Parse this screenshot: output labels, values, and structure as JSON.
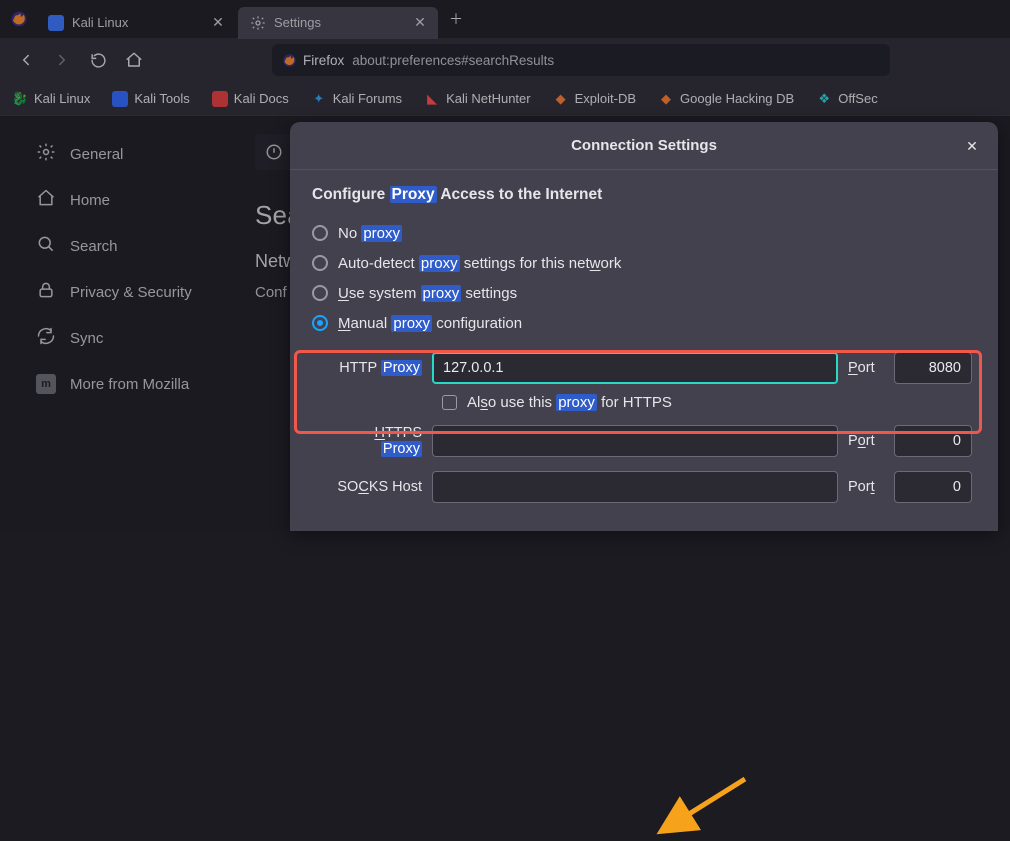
{
  "tabs": [
    {
      "title": "Kali Linux",
      "active": false
    },
    {
      "title": "Settings",
      "active": true
    }
  ],
  "urlbar": {
    "brand": "Firefox",
    "path": "about:preferences#searchResults"
  },
  "bookmarks": [
    {
      "label": "Kali Linux",
      "icon": "dragon-icon"
    },
    {
      "label": "Kali Tools",
      "icon": "tool-icon"
    },
    {
      "label": "Kali Docs",
      "icon": "doc-icon"
    },
    {
      "label": "Kali Forums",
      "icon": "forum-icon"
    },
    {
      "label": "Kali NetHunter",
      "icon": "nethunter-icon"
    },
    {
      "label": "Exploit-DB",
      "icon": "exploit-icon"
    },
    {
      "label": "Google Hacking DB",
      "icon": "gh-icon"
    },
    {
      "label": "OffSec",
      "icon": "offsec-icon"
    }
  ],
  "sidebar": {
    "items": [
      {
        "label": "General",
        "icon": "gear-icon"
      },
      {
        "label": "Home",
        "icon": "home-icon"
      },
      {
        "label": "Search",
        "icon": "search-icon"
      },
      {
        "label": "Privacy & Security",
        "icon": "lock-icon"
      },
      {
        "label": "Sync",
        "icon": "sync-icon"
      },
      {
        "label": "More from Mozilla",
        "icon": "mozilla-icon"
      }
    ]
  },
  "content": {
    "heading": "Sea",
    "subheading": "Netw",
    "desc": "Conf"
  },
  "modal": {
    "title": "Connection Settings",
    "section_title_pre": "Configure ",
    "section_title_hl": "Proxy",
    "section_title_post": " Access to the Internet",
    "radios": {
      "no_proxy_pre": "No ",
      "no_proxy_hl": "proxy",
      "autodetect_pre": "Auto-detect ",
      "autodetect_hl": "proxy",
      "autodetect_post": " settings for this net",
      "autodetect_accesskey": "w",
      "autodetect_tail": "ork",
      "system_accesskey": "U",
      "system_pre": "se system ",
      "system_hl": "proxy",
      "system_post": " settings",
      "manual_accesskey": "M",
      "manual_pre": "anual ",
      "manual_hl": "proxy",
      "manual_post": " configuration"
    },
    "http": {
      "label_pre": "HTTP ",
      "label_hl": "Proxy",
      "host": "127.0.0.1",
      "port_label_accesskey": "P",
      "port_label_post": "ort",
      "port": "8080"
    },
    "also_https": {
      "pre": "Al",
      "accesskey": "s",
      "mid": "o use this ",
      "hl": "proxy",
      "post": " for HTTPS"
    },
    "https": {
      "label_accesskey": "H",
      "label_pre": "TTPS ",
      "label_hl": "Proxy",
      "host": "",
      "port_label_accesskey": "o",
      "port_label_pre": "P",
      "port_label_post": "rt",
      "port": "0"
    },
    "socks": {
      "label_accesskey": "C",
      "label_pre": "SO",
      "label_post": "KS Host",
      "host": "",
      "port_label_accesskey": "t",
      "port_label_pre": "Por",
      "port": "0"
    }
  }
}
